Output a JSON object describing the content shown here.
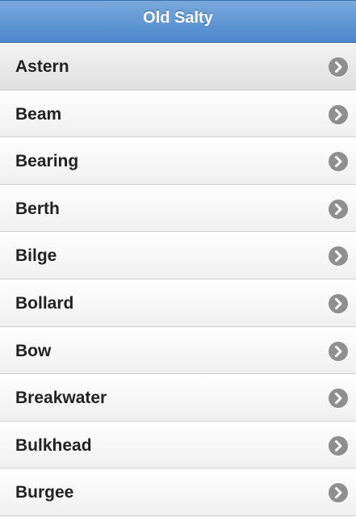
{
  "header": {
    "title": "Old Salty"
  },
  "list": {
    "items": [
      {
        "label": "Astern"
      },
      {
        "label": "Beam"
      },
      {
        "label": "Bearing"
      },
      {
        "label": "Berth"
      },
      {
        "label": "Bilge"
      },
      {
        "label": "Bollard"
      },
      {
        "label": "Bow"
      },
      {
        "label": "Breakwater"
      },
      {
        "label": "Bulkhead"
      },
      {
        "label": "Burgee"
      }
    ],
    "item_icon": "chevron-right-icon"
  },
  "colors": {
    "header_top": "#7aa9dc",
    "header_bottom": "#4a88cd",
    "arrow": "#8f8f8f",
    "text": "#222222"
  }
}
